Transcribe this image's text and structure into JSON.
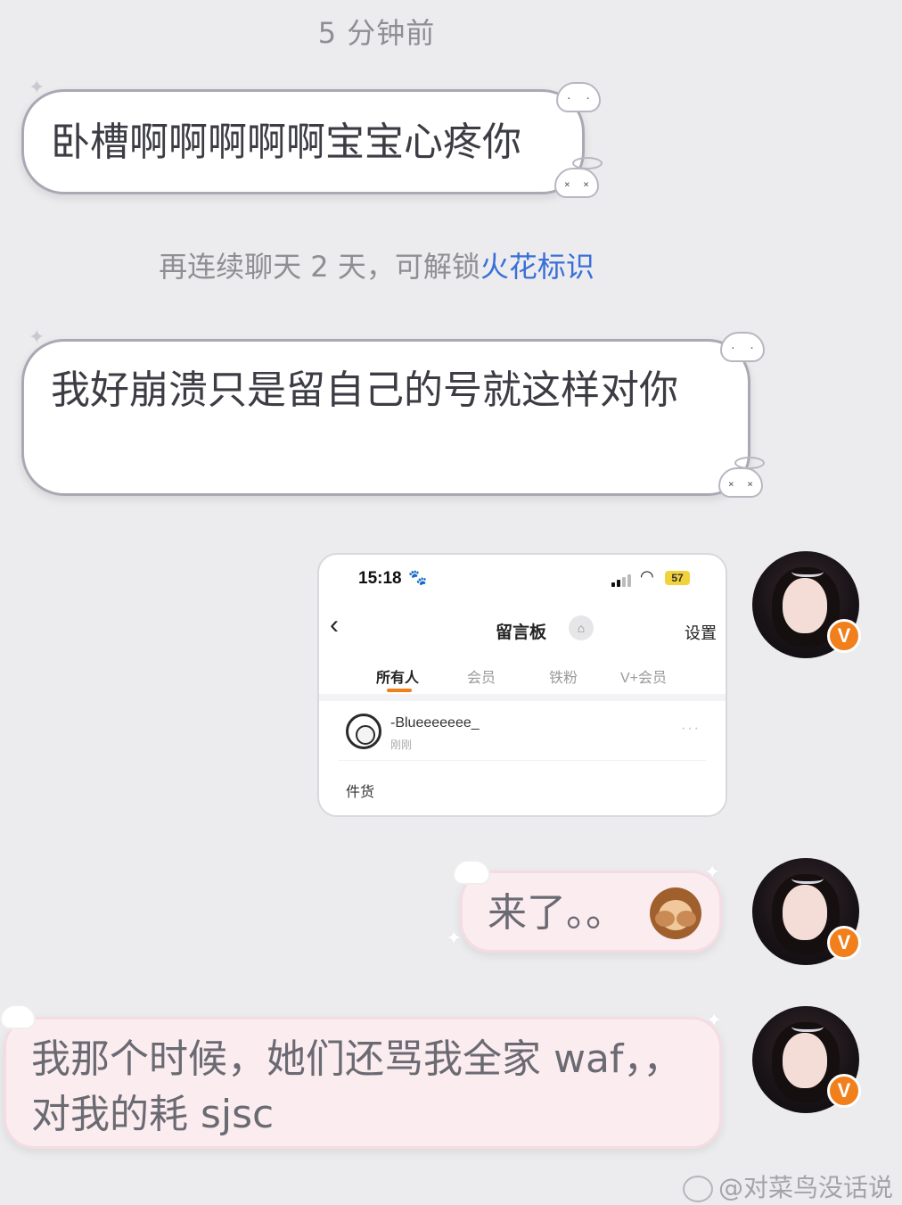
{
  "chat": {
    "timestamp": "5 分钟前",
    "messages": [
      {
        "side": "incoming",
        "text": "卧槽啊啊啊啊啊宝宝心疼你"
      },
      {
        "side": "incoming",
        "text": "我好崩溃只是留自己的号就这样对你"
      },
      {
        "side": "outgoing",
        "type": "image",
        "text": ""
      },
      {
        "side": "outgoing",
        "text": "来了。。",
        "emoji": "see-no-evil-monkey"
      },
      {
        "side": "outgoing",
        "text": "我那个时候，她们还骂我全家 waf，，对我的耗 sjsc"
      }
    ],
    "streak_notice": {
      "prefix": "再连续聊天 2 天，可解锁",
      "highlight": "火花标识",
      "highlight_color": "#3a6fd8"
    }
  },
  "shared_screenshot": {
    "status_time": "15:18",
    "battery": "57",
    "page_title": "留言板",
    "settings_label": "设置",
    "tabs": [
      "所有人",
      "会员",
      "铁粉",
      "V+会员"
    ],
    "active_tab": "所有人",
    "post": {
      "username": "-Blueeeeeee_",
      "time": "刚刚",
      "content": "件货"
    }
  },
  "avatar": {
    "badge": "V",
    "badge_color": "#f07f1c"
  },
  "watermark": "@对菜鸟没话说",
  "colors": {
    "incoming_bubble": "#ffffff",
    "outgoing_bubble": "#fbecef",
    "accent": "#f07f1c"
  }
}
